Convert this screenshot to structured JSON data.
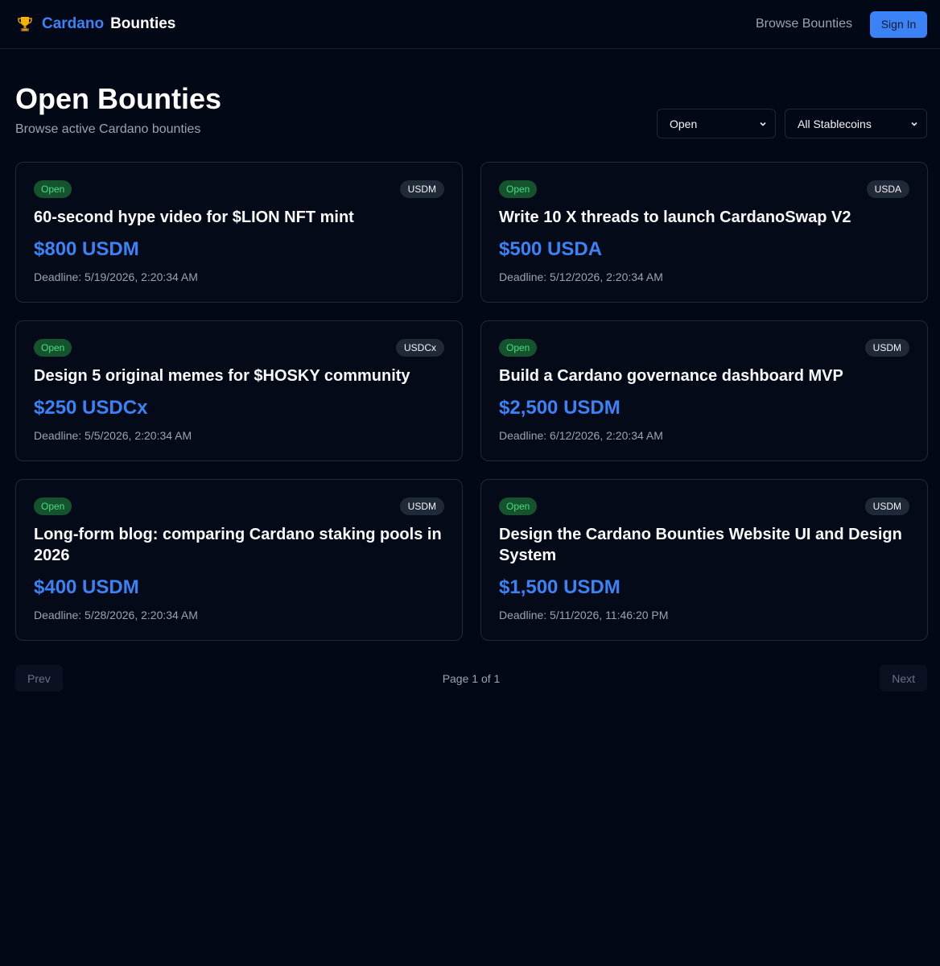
{
  "header": {
    "brand_accent": "Cardano",
    "brand_main": "Bounties",
    "nav_browse": "Browse Bounties",
    "sign_in": "Sign In"
  },
  "page": {
    "title": "Open Bounties",
    "subtitle": "Browse active Cardano bounties"
  },
  "filters": {
    "status": "Open",
    "coin": "All Stablecoins"
  },
  "bounties": [
    {
      "status": "Open",
      "coin": "USDM",
      "title": "60-second hype video for $LION NFT mint",
      "amount": "$800 USDM",
      "deadline": "Deadline: 5/19/2026, 2:20:34 AM"
    },
    {
      "status": "Open",
      "coin": "USDA",
      "title": "Write 10 X threads to launch CardanoSwap V2",
      "amount": "$500 USDA",
      "deadline": "Deadline: 5/12/2026, 2:20:34 AM"
    },
    {
      "status": "Open",
      "coin": "USDCx",
      "title": "Design 5 original memes for $HOSKY community",
      "amount": "$250 USDCx",
      "deadline": "Deadline: 5/5/2026, 2:20:34 AM"
    },
    {
      "status": "Open",
      "coin": "USDM",
      "title": "Build a Cardano governance dashboard MVP",
      "amount": "$2,500 USDM",
      "deadline": "Deadline: 6/12/2026, 2:20:34 AM"
    },
    {
      "status": "Open",
      "coin": "USDM",
      "title": "Long-form blog: comparing Cardano staking pools in 2026",
      "amount": "$400 USDM",
      "deadline": "Deadline: 5/28/2026, 2:20:34 AM"
    },
    {
      "status": "Open",
      "coin": "USDM",
      "title": "Design the Cardano Bounties Website UI and Design System",
      "amount": "$1,500 USDM",
      "deadline": "Deadline: 5/11/2026, 11:46:20 PM"
    }
  ],
  "pagination": {
    "prev": "Prev",
    "info": "Page 1 of 1",
    "next": "Next"
  },
  "colors": {
    "background": "#030816",
    "accent": "#3b82f6",
    "open_badge_bg": "#14532d",
    "open_badge_text": "#4ade80"
  },
  "icons": {
    "logo": "trophy-icon",
    "select": "chevron-down-icon"
  }
}
